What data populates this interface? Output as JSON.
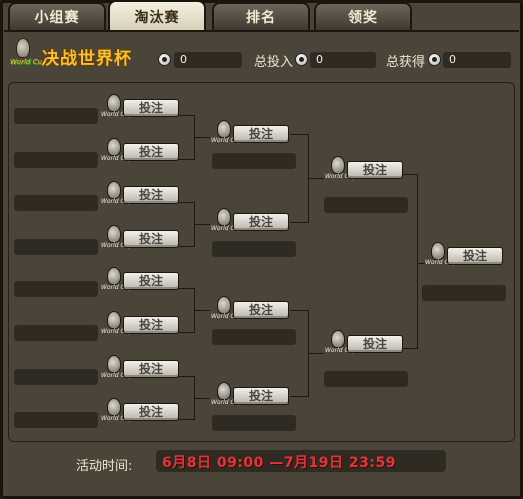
{
  "tabs": [
    {
      "label": "小组赛",
      "active": false
    },
    {
      "label": "淘汰赛",
      "active": true
    },
    {
      "label": "排名",
      "active": false
    },
    {
      "label": "领奖",
      "active": false
    }
  ],
  "header": {
    "logo_text": "World Cup",
    "title": "决战世界杯",
    "balance_value": "0",
    "invest_label": "总投入",
    "invest_value": "0",
    "gain_label": "总获得",
    "gain_value": "0"
  },
  "bracket": {
    "bet_label": "投注",
    "logo_text": "World Cup",
    "round_of_16": [
      {
        "team_a": "",
        "team_b": ""
      },
      {
        "team_a": "",
        "team_b": ""
      },
      {
        "team_a": "",
        "team_b": ""
      },
      {
        "team_a": "",
        "team_b": ""
      },
      {
        "team_a": "",
        "team_b": ""
      },
      {
        "team_a": "",
        "team_b": ""
      },
      {
        "team_a": "",
        "team_b": ""
      },
      {
        "team_a": "",
        "team_b": ""
      }
    ]
  },
  "footer": {
    "label": "活动时间:",
    "time_range": "6月8日 09:00 —7月19日 23:59"
  },
  "colors": {
    "accent_title": "#f2c230",
    "time_red": "#e2353a",
    "slot_dark": "#2f2a22",
    "panel_bg": "#4a4439"
  },
  "icons": [
    "world-cup-trophy-icon",
    "football-coin-icon"
  ]
}
